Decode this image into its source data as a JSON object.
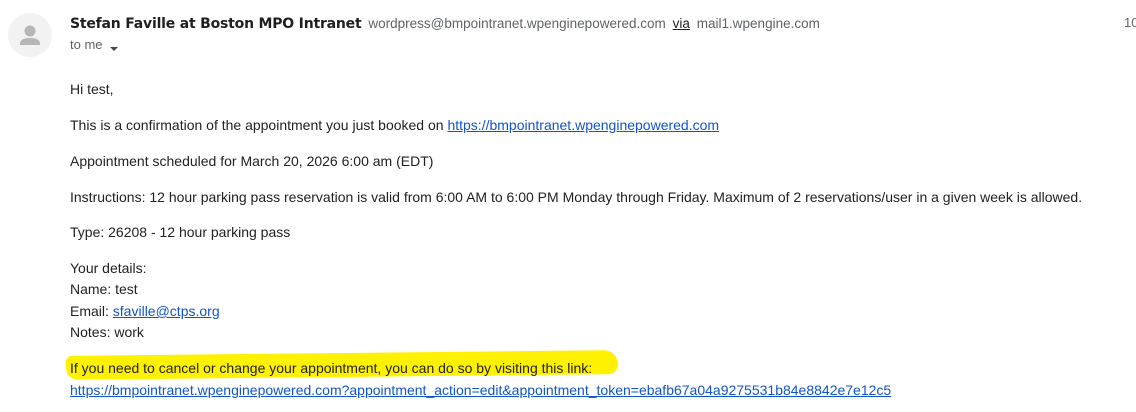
{
  "header": {
    "sender_name": "Stefan Faville at Boston MPO Intranet",
    "sender_email": "wordpress@bmpointranet.wpenginepowered.com",
    "via_label": "via",
    "via_host": "mail1.wpengine.com",
    "recipient_label": "to me",
    "date_fragment": "10"
  },
  "message": {
    "greeting": "Hi test,",
    "confirmation_prefix": "This is a confirmation of the appointment you just booked on ",
    "confirmation_link": "https://bmpointranet.wpenginepowered.com",
    "scheduled": "Appointment scheduled for March 20, 2026 6:00 am (EDT)",
    "instructions": "Instructions: 12 hour parking pass reservation is valid from 6:00 AM to 6:00 PM Monday through Friday. Maximum of 2 reservations/user in a given week is allowed.",
    "type": "Type: 26208 - 12 hour parking pass",
    "details_heading": "Your details:",
    "name_line": "Name: test",
    "email_prefix": "Email: ",
    "email_link": "sfaville@ctps.org",
    "notes_line": "Notes: work",
    "cancel_text": "If you need to cancel or change your appointment, you can do so by visiting this link:",
    "cancel_link": "https://bmpointranet.wpenginepowered.com?appointment_action=edit&appointment_token=ebafb67a04a9275531b84e8842e7e12c5"
  },
  "colors": {
    "link": "#1155cc",
    "highlight": "#fff200",
    "muted": "#5f6368"
  },
  "icons": {
    "avatar": "person-icon",
    "recipient_toggle": "caret-down-icon"
  }
}
